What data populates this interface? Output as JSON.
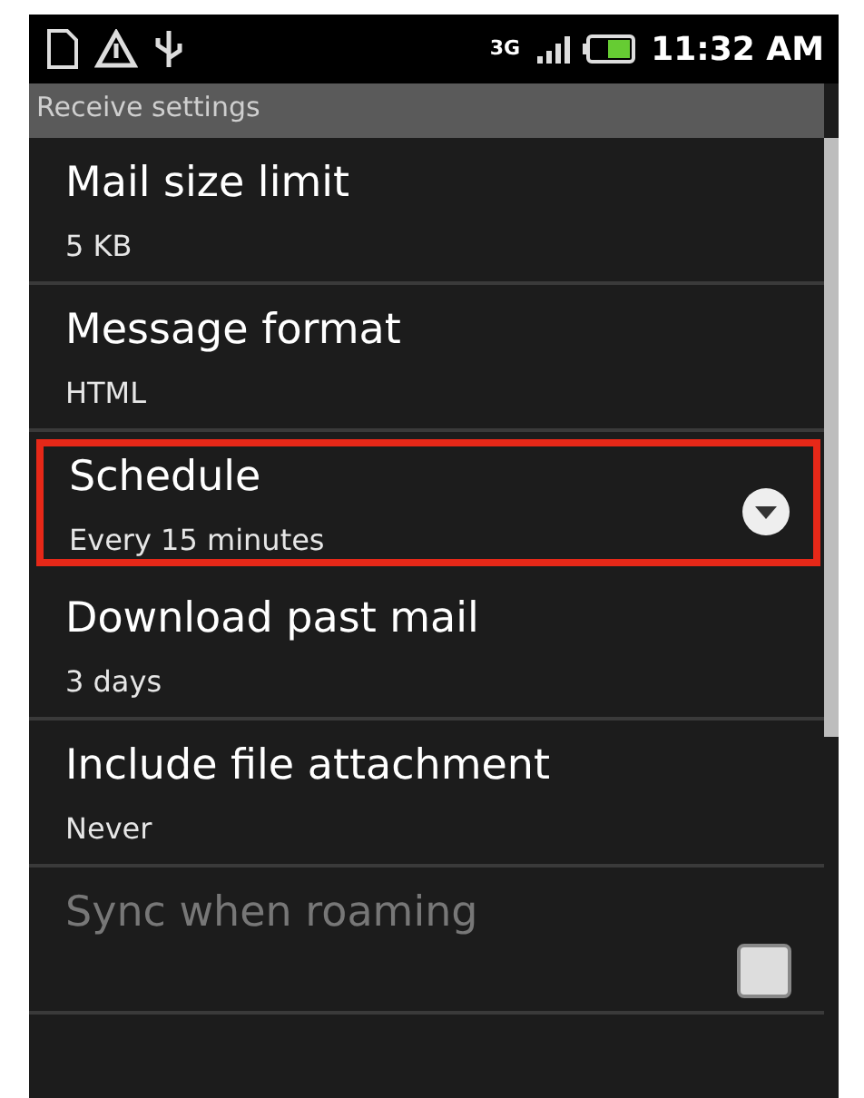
{
  "status_bar": {
    "time": "11:32 AM",
    "network": "3G"
  },
  "header": {
    "title": "Receive settings"
  },
  "items": [
    {
      "kind": "plain",
      "title": "Mail size limit",
      "value": "5 KB",
      "highlighted": false,
      "disabled": false
    },
    {
      "kind": "plain",
      "title": "Message format",
      "value": "HTML",
      "highlighted": false,
      "disabled": false
    },
    {
      "kind": "dropdown",
      "title": "Schedule",
      "value": "Every 15 minutes",
      "highlighted": true,
      "disabled": false
    },
    {
      "kind": "plain",
      "title": "Download past mail",
      "value": "3 days",
      "highlighted": false,
      "disabled": false
    },
    {
      "kind": "plain",
      "title": "Include file attachment",
      "value": "Never",
      "highlighted": false,
      "disabled": false
    },
    {
      "kind": "checkbox",
      "title": "Sync when roaming",
      "highlighted": false,
      "disabled": true,
      "checked": false
    }
  ]
}
